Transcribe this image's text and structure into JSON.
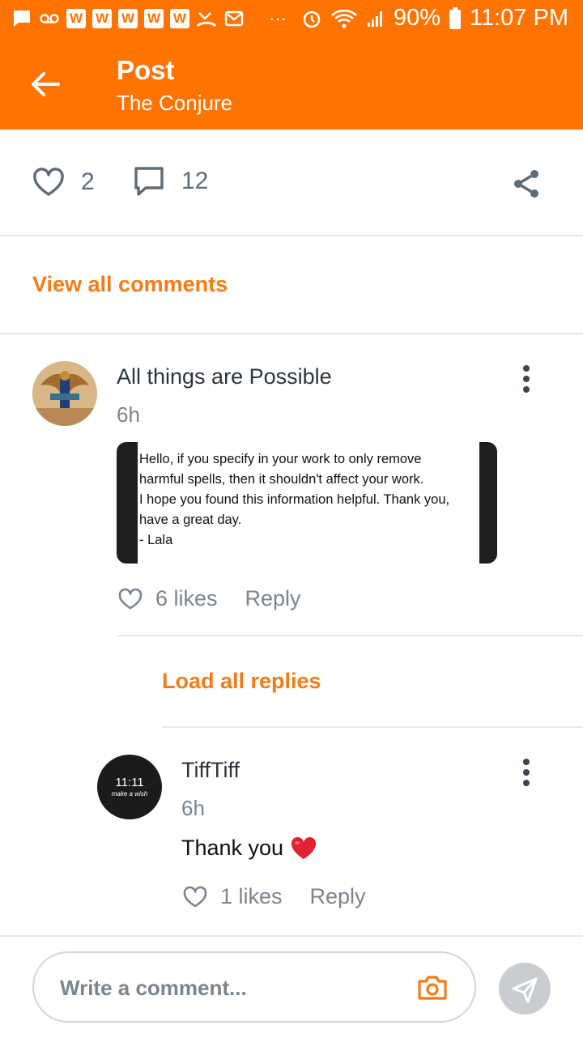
{
  "status_bar": {
    "app_letters": [
      "W",
      "W",
      "W",
      "W",
      "W"
    ],
    "dots": "···",
    "battery": "90%",
    "time": "11:07 PM"
  },
  "app_bar": {
    "title": "Post",
    "subtitle": "The Conjure"
  },
  "post_actions": {
    "likes": "2",
    "comments": "12"
  },
  "view_all_comments": "View all comments",
  "comments": [
    {
      "author": "All things are Possible",
      "time": "6h",
      "image_text": "Hello, if you specify in your work to only remove\nharmful spells, then it shouldn't affect your work.\nI hope you found this information helpful. Thank you,\nhave a great day.\n- Lala",
      "likes": "6 likes",
      "reply": "Reply"
    }
  ],
  "load_all_replies": "Load all replies",
  "replies": [
    {
      "author": "TiffTiff",
      "time": "6h",
      "avatar_text": "11:11",
      "avatar_subtext": "make a wish",
      "text": "Thank you",
      "likes": "1 likes",
      "reply": "Reply"
    }
  ],
  "composer": {
    "placeholder": "Write a comment..."
  },
  "colors": {
    "brand": "#ff7302",
    "link": "#f57b16",
    "muted": "#7a858f"
  }
}
